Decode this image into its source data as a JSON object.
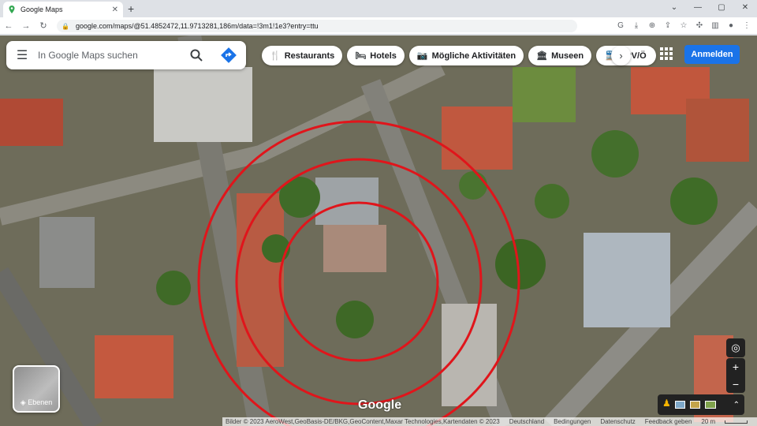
{
  "browser": {
    "tab_title": "Google Maps",
    "url": "google.com/maps/@51.4852472,11.9713281,186m/data=!3m1!1e3?entry=ttu"
  },
  "maps": {
    "search_placeholder": "In Google Maps suchen",
    "chips": [
      {
        "label": "Restaurants",
        "icon": "fork-knife-icon"
      },
      {
        "label": "Hotels",
        "icon": "bed-icon"
      },
      {
        "label": "Mögliche Aktivitäten",
        "icon": "camera-icon"
      },
      {
        "label": "Museen",
        "icon": "museum-icon"
      },
      {
        "label": "ÖPV/Ö",
        "icon": "train-icon"
      }
    ],
    "signin_label": "Anmelden",
    "layers_label": "Ebenen",
    "logo_text": "Google",
    "footer": {
      "imagery": "Bilder © 2023 AeroWest,GeoBasis-DE/BKG,GeoContent,Maxar Technologies,Kartendaten © 2023",
      "country": "Deutschland",
      "terms": "Bedingungen",
      "privacy": "Datenschutz",
      "feedback": "Feedback geben",
      "scale": "20 m"
    }
  },
  "colors": {
    "accent": "#1a73e8",
    "circles": "#e0151b"
  }
}
